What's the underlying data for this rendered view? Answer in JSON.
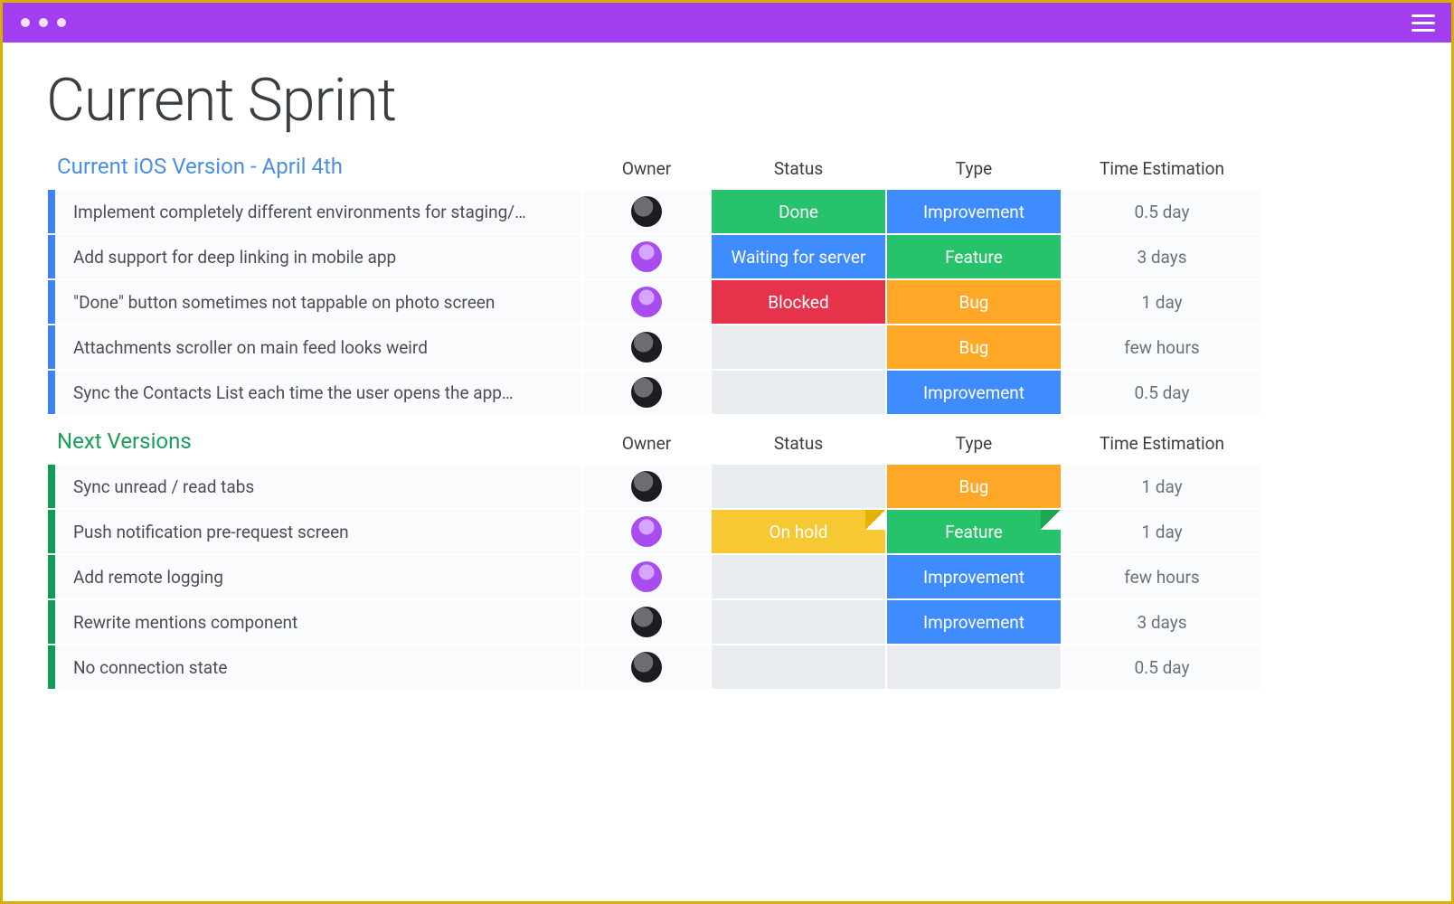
{
  "page": {
    "title": "Current Sprint"
  },
  "columns": {
    "owner": "Owner",
    "status": "Status",
    "type": "Type",
    "time": "Time Estimation"
  },
  "avatars": {
    "dark": "dark",
    "purple": "purple"
  },
  "colors": {
    "purple": "#a23df0",
    "frame": "#d6af00",
    "pill_green": "#27c26c",
    "pill_blue": "#3f8cff",
    "pill_red": "#e6324b",
    "pill_orange": "#ffa726",
    "pill_yellow": "#f6c934",
    "bar_blue": "#3b82f6",
    "bar_green": "#0f9d58"
  },
  "sections": [
    {
      "title": "Current iOS Version - April 4th",
      "titleColor": "blue",
      "barColor": "blue",
      "rows": [
        {
          "title": "Implement completely different environments for staging/…",
          "owner": "dark",
          "status": {
            "label": "Done",
            "color": "green"
          },
          "type": {
            "label": "Improvement",
            "color": "blue"
          },
          "time": "0.5 day"
        },
        {
          "title": "Add support for deep linking in mobile app",
          "owner": "purple",
          "status": {
            "label": "Waiting for server",
            "color": "blue"
          },
          "type": {
            "label": "Feature",
            "color": "green"
          },
          "time": "3 days"
        },
        {
          "title": "\"Done\" button sometimes not tappable on photo screen",
          "owner": "purple",
          "status": {
            "label": "Blocked",
            "color": "red"
          },
          "type": {
            "label": "Bug",
            "color": "orange"
          },
          "time": "1 day"
        },
        {
          "title": "Attachments scroller on main feed looks weird",
          "owner": "dark",
          "status": {
            "label": "",
            "color": ""
          },
          "type": {
            "label": "Bug",
            "color": "orange"
          },
          "time": "few hours"
        },
        {
          "title": "Sync the Contacts List each time the user opens the app…",
          "owner": "dark",
          "status": {
            "label": "",
            "color": ""
          },
          "type": {
            "label": "Improvement",
            "color": "blue"
          },
          "time": "0.5 day"
        }
      ]
    },
    {
      "title": "Next Versions",
      "titleColor": "green",
      "barColor": "green",
      "rows": [
        {
          "title": "Sync unread / read tabs",
          "owner": "dark",
          "status": {
            "label": "",
            "color": ""
          },
          "type": {
            "label": "Bug",
            "color": "orange"
          },
          "time": "1 day"
        },
        {
          "title": "Push notification pre-request screen",
          "owner": "purple",
          "status": {
            "label": "On hold",
            "color": "yellow",
            "fold": true
          },
          "type": {
            "label": "Feature",
            "color": "green",
            "fold": true
          },
          "time": "1 day"
        },
        {
          "title": "Add remote logging",
          "owner": "purple",
          "status": {
            "label": "",
            "color": ""
          },
          "type": {
            "label": "Improvement",
            "color": "blue"
          },
          "time": "few hours"
        },
        {
          "title": "Rewrite mentions component",
          "owner": "dark",
          "status": {
            "label": "",
            "color": ""
          },
          "type": {
            "label": "Improvement",
            "color": "blue"
          },
          "time": "3 days"
        },
        {
          "title": "No connection state",
          "owner": "dark",
          "status": {
            "label": "",
            "color": ""
          },
          "type": {
            "label": "",
            "color": ""
          },
          "time": "0.5 day"
        }
      ]
    }
  ]
}
